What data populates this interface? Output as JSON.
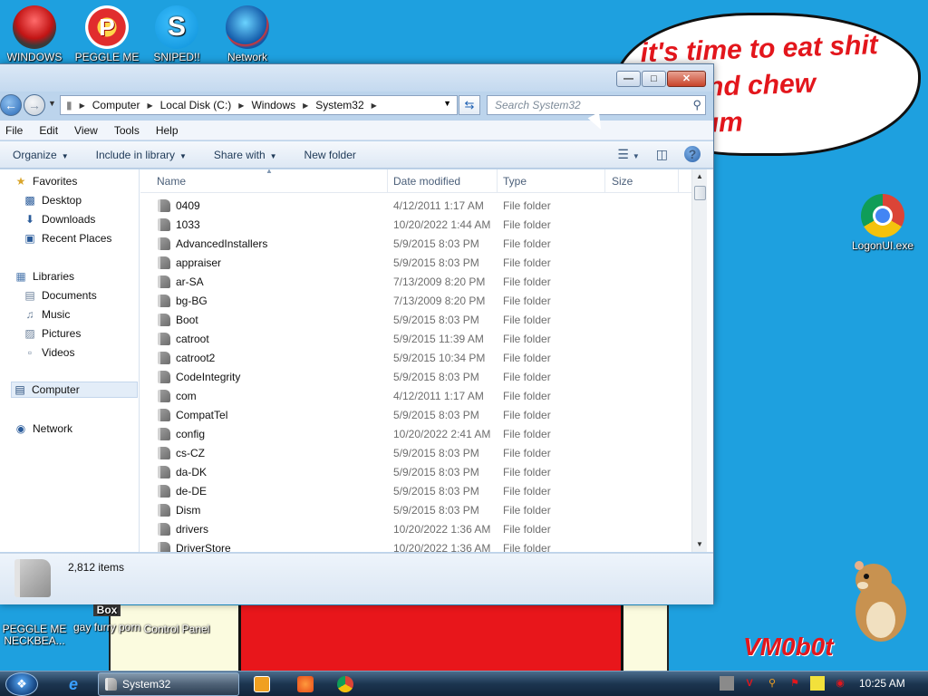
{
  "desktop": {
    "icons_top": [
      {
        "label": "WINDOWS",
        "icon": "windows-bowl-icon"
      },
      {
        "label": "PEGGLE ME",
        "icon": "peggle-icon"
      },
      {
        "label": "SNIPED!! EPIC",
        "icon": "skype-icon"
      },
      {
        "label": "Network",
        "icon": "network-globe-icon"
      }
    ],
    "icon_chrome_label": "LogonUI.exe",
    "icons_bottom": [
      {
        "label": "PEGGLE ME NECKBEA..."
      },
      {
        "label": "gay furry porn"
      },
      {
        "label": "Control Panel"
      }
    ],
    "box_badge": "Box",
    "speech_bubble": [
      "it's time to eat shit",
      "ie and chew",
      "e gum"
    ],
    "signature": "VM0b0t"
  },
  "window": {
    "breadcrumbs": [
      "Computer",
      "Local Disk (C:)",
      "Windows",
      "System32"
    ],
    "search_placeholder": "Search System32",
    "menu": [
      "File",
      "Edit",
      "View",
      "Tools",
      "Help"
    ],
    "commands": [
      {
        "label": "Organize",
        "dropdown": true
      },
      {
        "label": "Include in library",
        "dropdown": true
      },
      {
        "label": "Share with",
        "dropdown": true
      },
      {
        "label": "New folder",
        "dropdown": false
      }
    ],
    "nav": {
      "favorites": "Favorites",
      "favorites_items": [
        "Desktop",
        "Downloads",
        "Recent Places"
      ],
      "libraries": "Libraries",
      "libraries_items": [
        "Documents",
        "Music",
        "Pictures",
        "Videos"
      ],
      "computer": "Computer",
      "network": "Network"
    },
    "columns": [
      "Name",
      "Date modified",
      "Type",
      "Size"
    ],
    "rows": [
      {
        "name": "0409",
        "date": "4/12/2011 1:17 AM",
        "type": "File folder"
      },
      {
        "name": "1033",
        "date": "10/20/2022 1:44 AM",
        "type": "File folder"
      },
      {
        "name": "AdvancedInstallers",
        "date": "5/9/2015 8:03 PM",
        "type": "File folder"
      },
      {
        "name": "appraiser",
        "date": "5/9/2015 8:03 PM",
        "type": "File folder"
      },
      {
        "name": "ar-SA",
        "date": "7/13/2009 8:20 PM",
        "type": "File folder"
      },
      {
        "name": "bg-BG",
        "date": "7/13/2009 8:20 PM",
        "type": "File folder"
      },
      {
        "name": "Boot",
        "date": "5/9/2015 8:03 PM",
        "type": "File folder"
      },
      {
        "name": "catroot",
        "date": "5/9/2015 11:39 AM",
        "type": "File folder"
      },
      {
        "name": "catroot2",
        "date": "5/9/2015 10:34 PM",
        "type": "File folder"
      },
      {
        "name": "CodeIntegrity",
        "date": "5/9/2015 8:03 PM",
        "type": "File folder"
      },
      {
        "name": "com",
        "date": "4/12/2011 1:17 AM",
        "type": "File folder"
      },
      {
        "name": "CompatTel",
        "date": "5/9/2015 8:03 PM",
        "type": "File folder"
      },
      {
        "name": "config",
        "date": "10/20/2022 2:41 AM",
        "type": "File folder"
      },
      {
        "name": "cs-CZ",
        "date": "5/9/2015 8:03 PM",
        "type": "File folder"
      },
      {
        "name": "da-DK",
        "date": "5/9/2015 8:03 PM",
        "type": "File folder"
      },
      {
        "name": "de-DE",
        "date": "5/9/2015 8:03 PM",
        "type": "File folder"
      },
      {
        "name": "Dism",
        "date": "5/9/2015 8:03 PM",
        "type": "File folder"
      },
      {
        "name": "drivers",
        "date": "10/20/2022 1:36 AM",
        "type": "File folder"
      },
      {
        "name": "DriverStore",
        "date": "10/20/2022 1:36 AM",
        "type": "File folder"
      }
    ],
    "item_count": "2,812 items"
  },
  "taskbar": {
    "task_label": "System32",
    "clock": "10:25 AM"
  }
}
